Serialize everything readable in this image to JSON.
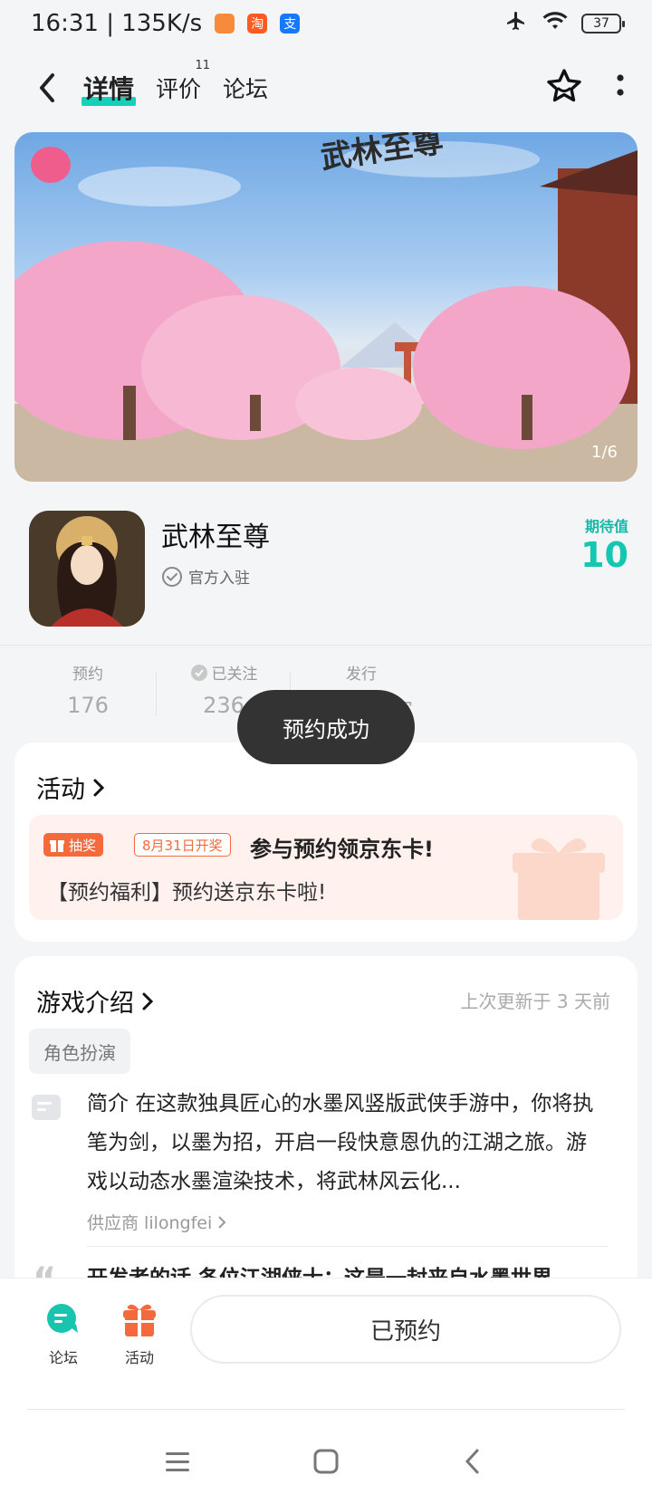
{
  "status_bar": {
    "time_speed": "16:31 | 135K/s",
    "app_badges": [
      "",
      "淘",
      "支"
    ],
    "battery": "37"
  },
  "nav": {
    "tabs": [
      {
        "label": "详情",
        "active": true
      },
      {
        "label": "评价",
        "badge": "11"
      },
      {
        "label": "论坛"
      }
    ]
  },
  "banner": {
    "page_indicator": "1/6"
  },
  "app": {
    "name": "武林至尊",
    "official_label": "官方入驻",
    "expect_label": "期待值",
    "expect_value": "10"
  },
  "stats": [
    {
      "label": "预约",
      "value": "176"
    },
    {
      "label": "已关注",
      "value": "236"
    },
    {
      "label": "发行",
      "value": "官"
    }
  ],
  "toast": "预约成功",
  "activity": {
    "title": "活动",
    "tag": "抽奖",
    "date_tag": "8月31日开奖",
    "promo_title": "参与预约领京东卡!",
    "promo_desc": "【预约福利】预约送京东卡啦!"
  },
  "intro": {
    "title": "游戏介绍",
    "updated": "上次更新于 3 天前",
    "genre": "角色扮演",
    "desc_label": "简介",
    "desc_text": "在这款独具匠心的水墨风竖版武侠手游中，你将执笔为剑，以墨为招，开启一段快意恩仇的江湖之旅。游戏以动态水墨渲染技术，将武林风云化...",
    "supplier": "供应商 lilongfei",
    "dev_text": "开发者的话 各位江湖侠士：这是一封来自水墨世界"
  },
  "bottom_bar": {
    "forum_label": "论坛",
    "activity_label": "活动",
    "reserved_label": "已预约"
  },
  "colors": {
    "accent": "#15d1b8",
    "orange": "#f56a3c",
    "toast_bg": "#333333"
  }
}
